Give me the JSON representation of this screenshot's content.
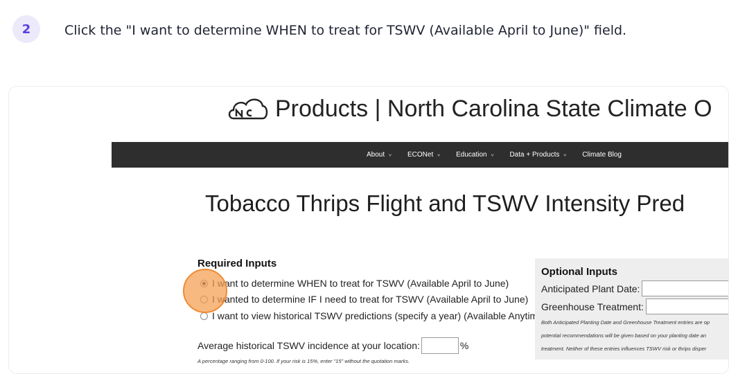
{
  "step": {
    "number": "2",
    "instruction": "Click the \"I want to determine WHEN to treat for TSWV (Available April to June)\" field."
  },
  "site": {
    "title": "Products | North Carolina State Climate O",
    "logo": "nc-cloud-logo"
  },
  "nav": {
    "items": [
      {
        "label": "About",
        "has_dropdown": true
      },
      {
        "label": "ECONet",
        "has_dropdown": true
      },
      {
        "label": "Education",
        "has_dropdown": true
      },
      {
        "label": "Data + Products",
        "has_dropdown": true
      },
      {
        "label": "Climate Blog",
        "has_dropdown": false
      }
    ]
  },
  "page": {
    "title": "Tobacco Thrips Flight and TSWV Intensity Pred"
  },
  "required": {
    "title": "Required Inputs",
    "options": [
      {
        "label": "I want to determine WHEN to treat for TSWV (Available April to June)",
        "checked": true
      },
      {
        "label": "I wanted to determine IF I need to treat for TSWV (Available April to June)",
        "checked": false
      },
      {
        "label": "I want to view historical TSWV predictions (specify a year) (Available Anytime)",
        "checked": false
      }
    ],
    "historical_label": "Average historical TSWV incidence at your location:",
    "historical_value": "",
    "historical_unit": "%",
    "hint": "A percentage ranging from 0-100. If your risk is 15%, enter \"15\" without the quotation marks."
  },
  "optional": {
    "title": "Optional Inputs",
    "plant_date_label": "Anticipated Plant Date:",
    "plant_date_value": "",
    "greenhouse_label": "Greenhouse Treatment:",
    "greenhouse_value": "",
    "notes": [
      "Both Anticipated Planting Date and Greenhouse Treatment entries are op",
      "potential recommendations will be given based on your planting date an",
      "treatment. Neither of these entries influences TSWV risk or thrips disper"
    ]
  },
  "colors": {
    "badge_bg": "#ece9fb",
    "badge_text": "#5b3fe0",
    "navbar_bg": "#2e2e2e",
    "click_marker": "#f59e50"
  }
}
